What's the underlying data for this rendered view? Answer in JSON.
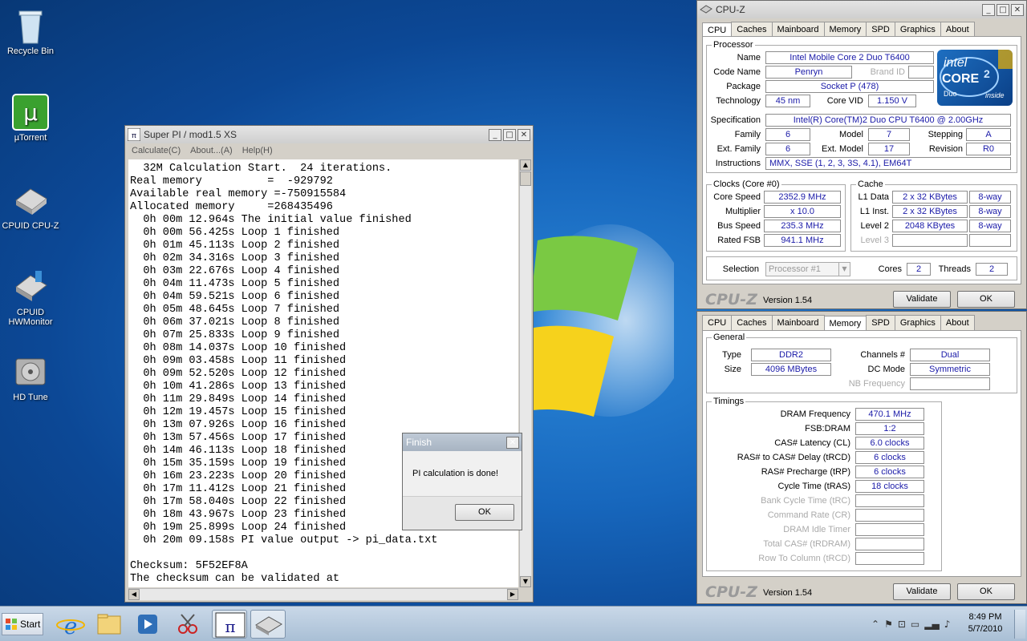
{
  "desktop": {
    "icons": [
      {
        "label": "Recycle Bin"
      },
      {
        "label": "µTorrent"
      },
      {
        "label": "CPUID CPU-Z"
      },
      {
        "label": "CPUID HWMonitor"
      },
      {
        "label": "HD Tune"
      }
    ]
  },
  "superpi": {
    "title": "Super PI / mod1.5 XS",
    "menu": [
      "Calculate(C)",
      "About...(A)",
      "Help(H)"
    ],
    "lines": [
      "  32M Calculation Start.  24 iterations.",
      "Real memory          =  -929792",
      "Available real memory =-750915584",
      "Allocated memory     =268435496",
      "  0h 00m 12.964s The initial value finished",
      "  0h 00m 56.425s Loop 1 finished",
      "  0h 01m 45.113s Loop 2 finished",
      "  0h 02m 34.316s Loop 3 finished",
      "  0h 03m 22.676s Loop 4 finished",
      "  0h 04m 11.473s Loop 5 finished",
      "  0h 04m 59.521s Loop 6 finished",
      "  0h 05m 48.645s Loop 7 finished",
      "  0h 06m 37.021s Loop 8 finished",
      "  0h 07m 25.833s Loop 9 finished",
      "  0h 08m 14.037s Loop 10 finished",
      "  0h 09m 03.458s Loop 11 finished",
      "  0h 09m 52.520s Loop 12 finished",
      "  0h 10m 41.286s Loop 13 finished",
      "  0h 11m 29.849s Loop 14 finished",
      "  0h 12m 19.457s Loop 15 finished",
      "  0h 13m 07.926s Loop 16 finished",
      "  0h 13m 57.456s Loop 17 finished",
      "  0h 14m 46.113s Loop 18 finished",
      "  0h 15m 35.159s Loop 19 finished",
      "  0h 16m 23.223s Loop 20 finished",
      "  0h 17m 11.412s Loop 21 finished",
      "  0h 17m 58.040s Loop 22 finished",
      "  0h 18m 43.967s Loop 23 finished",
      "  0h 19m 25.899s Loop 24 finished",
      "  0h 20m 09.158s PI value output -> pi_data.txt",
      "",
      "Checksum: 5F52EF8A",
      "The checksum can be validated at"
    ]
  },
  "finish": {
    "title": "Finish",
    "message": "PI calculation is done!",
    "ok": "OK"
  },
  "cpuz_cpu": {
    "title": "CPU-Z",
    "tabs": [
      "CPU",
      "Caches",
      "Mainboard",
      "Memory",
      "SPD",
      "Graphics",
      "About"
    ],
    "active_tab": "CPU",
    "processor_legend": "Processor",
    "name_label": "Name",
    "name": "Intel Mobile Core 2 Duo T6400",
    "codename_label": "Code Name",
    "codename": "Penryn",
    "brandid_label": "Brand ID",
    "package_label": "Package",
    "package": "Socket P (478)",
    "tech_label": "Technology",
    "tech": "45 nm",
    "corevid_label": "Core VID",
    "corevid": "1.150 V",
    "spec_label": "Specification",
    "spec": "Intel(R) Core(TM)2 Duo CPU     T6400  @ 2.00GHz",
    "family_label": "Family",
    "family": "6",
    "model_label": "Model",
    "model": "7",
    "stepping_label": "Stepping",
    "stepping": "A",
    "extfamily_label": "Ext. Family",
    "extfamily": "6",
    "extmodel_label": "Ext. Model",
    "extmodel": "17",
    "revision_label": "Revision",
    "revision": "R0",
    "instr_label": "Instructions",
    "instr": "MMX, SSE (1, 2, 3, 3S, 4.1), EM64T",
    "clocks_legend": "Clocks (Core #0)",
    "corespeed_label": "Core Speed",
    "corespeed": "2352.9 MHz",
    "multiplier_label": "Multiplier",
    "multiplier": "x 10.0",
    "busspeed_label": "Bus Speed",
    "busspeed": "235.3 MHz",
    "ratedfsb_label": "Rated FSB",
    "ratedfsb": "941.1 MHz",
    "cache_legend": "Cache",
    "l1d_label": "L1 Data",
    "l1d": "2 x 32 KBytes",
    "l1d_way": "8-way",
    "l1i_label": "L1 Inst.",
    "l1i": "2 x 32 KBytes",
    "l1i_way": "8-way",
    "l2_label": "Level 2",
    "l2": "2048 KBytes",
    "l2_way": "8-way",
    "l3_label": "Level 3",
    "selection_label": "Selection",
    "selection": "Processor #1",
    "cores_label": "Cores",
    "cores": "2",
    "threads_label": "Threads",
    "threads": "2",
    "brand": "CPU-Z",
    "version": "Version 1.54",
    "validate": "Validate",
    "ok": "OK",
    "intel_logo": {
      "top": "intel",
      "mid": "CORE",
      "sup": "2",
      "duo": "Duo",
      "inside": "inside"
    }
  },
  "cpuz_mem": {
    "tabs": [
      "CPU",
      "Caches",
      "Mainboard",
      "Memory",
      "SPD",
      "Graphics",
      "About"
    ],
    "active_tab": "Memory",
    "general_legend": "General",
    "type_label": "Type",
    "type": "DDR2",
    "channels_label": "Channels #",
    "channels": "Dual",
    "size_label": "Size",
    "size": "4096 MBytes",
    "dcmode_label": "DC Mode",
    "dcmode": "Symmetric",
    "nbfreq_label": "NB Frequency",
    "timings_legend": "Timings",
    "timings": [
      {
        "label": "DRAM Frequency",
        "value": "470.1 MHz",
        "dim": false
      },
      {
        "label": "FSB:DRAM",
        "value": "1:2",
        "dim": false
      },
      {
        "label": "CAS# Latency (CL)",
        "value": "6.0 clocks",
        "dim": false
      },
      {
        "label": "RAS# to CAS# Delay (tRCD)",
        "value": "6 clocks",
        "dim": false
      },
      {
        "label": "RAS# Precharge (tRP)",
        "value": "6 clocks",
        "dim": false
      },
      {
        "label": "Cycle Time (tRAS)",
        "value": "18 clocks",
        "dim": false
      },
      {
        "label": "Bank Cycle Time (tRC)",
        "value": "",
        "dim": true
      },
      {
        "label": "Command Rate (CR)",
        "value": "",
        "dim": true
      },
      {
        "label": "DRAM Idle Timer",
        "value": "",
        "dim": true
      },
      {
        "label": "Total CAS# (tRDRAM)",
        "value": "",
        "dim": true
      },
      {
        "label": "Row To Column (tRCD)",
        "value": "",
        "dim": true
      }
    ],
    "brand": "CPU-Z",
    "version": "Version 1.54",
    "validate": "Validate",
    "ok": "OK"
  },
  "taskbar": {
    "start": "Start",
    "time": "8:49 PM",
    "date": "5/7/2010"
  },
  "colors": {
    "value_text": "#1a1aa8",
    "desktop": "#1767bd"
  }
}
